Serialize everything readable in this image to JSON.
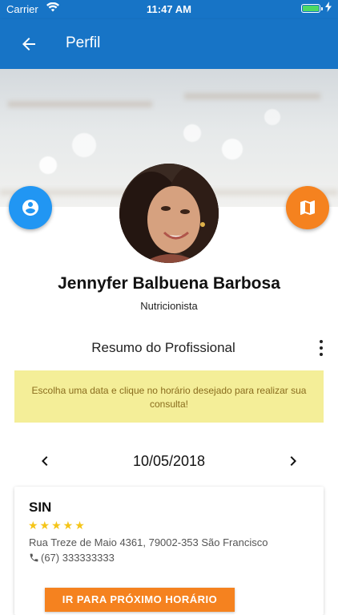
{
  "status_bar": {
    "carrier": "Carrier",
    "time": "11:47 AM"
  },
  "app_bar": {
    "title": "Perfil"
  },
  "profile": {
    "name": "Jennyfer Balbuena Barbosa",
    "role": "Nutricionista"
  },
  "summary": {
    "title": "Resumo do Profissional"
  },
  "notice": {
    "text": "Escolha uma data e clique no horário desejado para realizar sua consulta!"
  },
  "date_nav": {
    "date": "10/05/2018"
  },
  "clinic": {
    "name": "SIN",
    "stars": "★★★★★",
    "rating": 5,
    "address": "Rua Treze de Maio 4361, 79002-353 São Francisco",
    "phone": "(67) 333333333",
    "cta": "IR PARA PRÓXIMO HORÁRIO"
  },
  "colors": {
    "primary": "#1774c6",
    "fab_left": "#2196f3",
    "accent": "#f5821f",
    "notice_bg": "#f4ee98",
    "star": "#f5c518"
  },
  "icons": {
    "back": "arrow-left-icon",
    "fab_left": "account-circle-icon",
    "fab_right": "map-icon",
    "menu": "more-vertical-icon",
    "prev": "chevron-left-icon",
    "next": "chevron-right-icon",
    "phone": "phone-icon"
  }
}
